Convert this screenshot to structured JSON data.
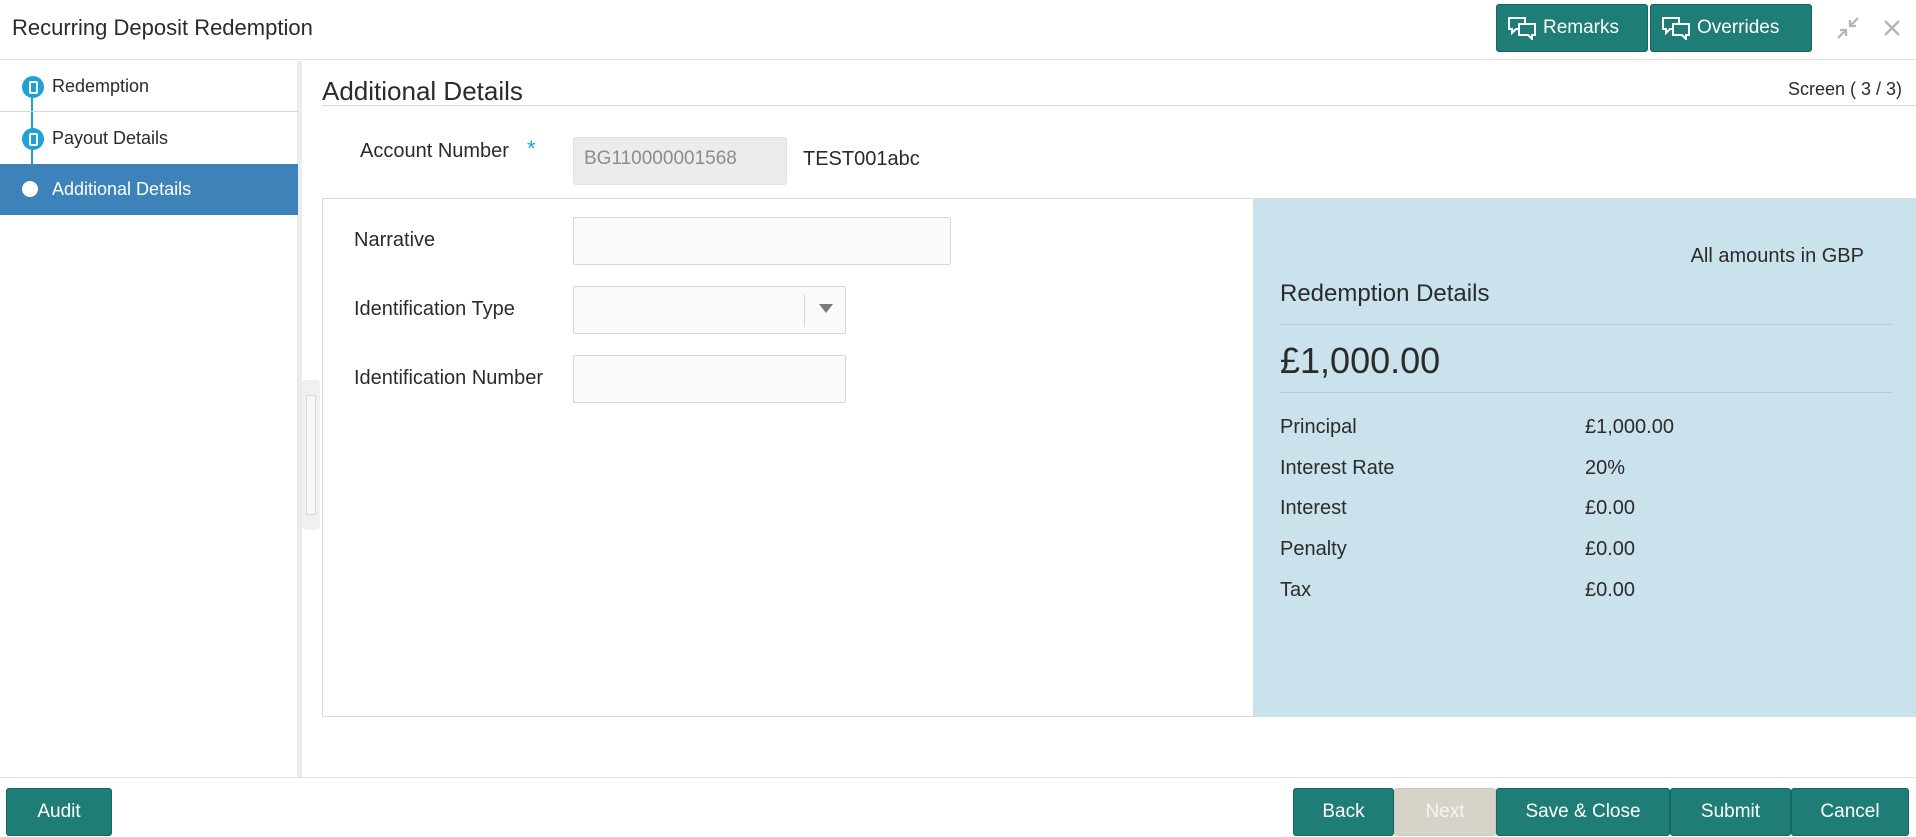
{
  "header": {
    "title": "Recurring Deposit Redemption",
    "remarks_label": "Remarks",
    "overrides_label": "Overrides"
  },
  "sidebar": {
    "items": [
      {
        "label": "Redemption",
        "state": "done"
      },
      {
        "label": "Payout Details",
        "state": "done"
      },
      {
        "label": "Additional Details",
        "state": "active"
      }
    ]
  },
  "main": {
    "section_title": "Additional Details",
    "screen_indicator": "Screen ( 3 / 3)",
    "account": {
      "label": "Account Number",
      "required_mark": "*",
      "value": "BG110000001568",
      "name": "TEST001abc"
    },
    "form": {
      "narrative_label": "Narrative",
      "narrative_value": "",
      "identification_type_label": "Identification Type",
      "identification_type_value": "",
      "identification_number_label": "Identification Number",
      "identification_number_value": ""
    }
  },
  "summary": {
    "currency_note": "All amounts in GBP",
    "title": "Redemption Details",
    "total": "£1,000.00",
    "rows": [
      {
        "label": "Principal",
        "value": "£1,000.00"
      },
      {
        "label": "Interest Rate",
        "value": "20%"
      },
      {
        "label": "Interest",
        "value": "£0.00"
      },
      {
        "label": "Penalty",
        "value": "£0.00"
      },
      {
        "label": "Tax",
        "value": "£0.00"
      }
    ]
  },
  "footer": {
    "audit_label": "Audit",
    "back_label": "Back",
    "next_label": "Next",
    "save_close_label": "Save & Close",
    "submit_label": "Submit",
    "cancel_label": "Cancel"
  },
  "colors": {
    "primary_button": "#1e7d76",
    "active_nav": "#3d82b9",
    "step_indicator": "#1ea2d6",
    "summary_panel": "#c9e2ec",
    "disabled_button": "#d8d3c9"
  },
  "icons": {
    "remarks": "chat-bubbles-icon",
    "overrides": "chat-bubbles-icon",
    "minimize": "minimize-arrows-icon",
    "close": "close-icon"
  }
}
